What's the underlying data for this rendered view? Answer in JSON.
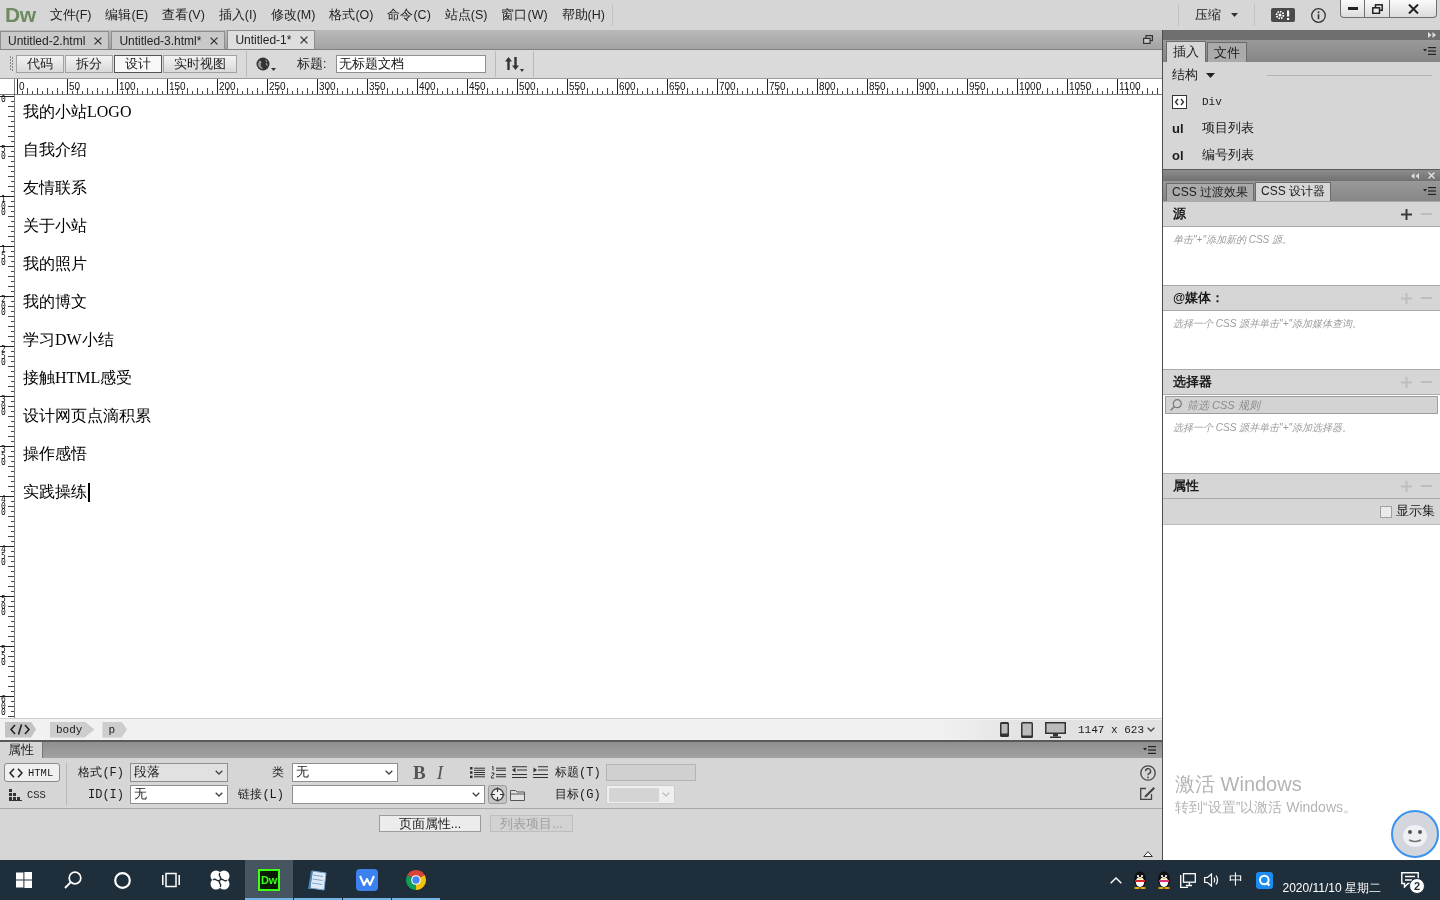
{
  "app": {
    "logo": "Dw",
    "menu": [
      "文件(F)",
      "编辑(E)",
      "查看(V)",
      "插入(I)",
      "修改(M)",
      "格式(O)",
      "命令(C)",
      "站点(S)",
      "窗口(W)",
      "帮助(H)"
    ],
    "workspace": "压缩"
  },
  "doc_tabs": [
    {
      "label": "Untitled-2.html",
      "selected": false
    },
    {
      "label": "Untitled-3.html*",
      "selected": false
    },
    {
      "label": "Untitled-1*",
      "selected": true
    }
  ],
  "toolbar": {
    "views": [
      {
        "label": "代码",
        "selected": false
      },
      {
        "label": "拆分",
        "selected": false
      },
      {
        "label": "设计",
        "selected": true
      },
      {
        "label": "实时视图",
        "selected": false
      }
    ],
    "title_label": "标题:",
    "title_value": "无标题文档"
  },
  "rulers": {
    "horizontal": [
      "0",
      "50",
      "100",
      "150",
      "200",
      "250",
      "300",
      "350",
      "400",
      "450",
      "500",
      "550",
      "600",
      "650",
      "700",
      "750",
      "800",
      "850",
      "900",
      "950",
      "1000",
      "1050",
      "1100"
    ],
    "vertical": [
      "0",
      "50",
      "100",
      "150",
      "200",
      "250",
      "300",
      "350",
      "400",
      "450",
      "500",
      "550",
      "600"
    ]
  },
  "document": {
    "paragraphs": [
      {
        "text": "我的小站LOGO",
        "caret": false
      },
      {
        "text": "自我介绍",
        "caret": false
      },
      {
        "text": "友情联系",
        "caret": false
      },
      {
        "text": "关于小站",
        "caret": false
      },
      {
        "text": "我的照片",
        "caret": false
      },
      {
        "text": "我的博文",
        "caret": false
      },
      {
        "text": "学习DW小结",
        "caret": false
      },
      {
        "text": "接触HTML感受",
        "caret": false
      },
      {
        "text": "设计网页点滴积累",
        "caret": false
      },
      {
        "text": "操作感悟",
        "caret": false
      },
      {
        "text": "实践操练",
        "caret": true
      }
    ]
  },
  "status_bar": {
    "tags": [
      "body",
      "p"
    ],
    "window_size": "1147 x 623"
  },
  "properties": {
    "title": "属性",
    "modes": [
      {
        "label": "HTML",
        "kind": "html",
        "selected": true
      },
      {
        "label": "CSS",
        "kind": "css",
        "selected": false
      }
    ],
    "format": {
      "label": "格式(F)",
      "value": "段落"
    },
    "id": {
      "label": "ID(I)",
      "value": "无"
    },
    "class": {
      "label": "类",
      "value": "无"
    },
    "link": {
      "label": "链接(L)"
    },
    "text_styles": [
      {
        "label": "B",
        "kind": "bold"
      },
      {
        "label": "I",
        "kind": "italic"
      }
    ],
    "heading": {
      "label": "标题(T)",
      "disabled": true
    },
    "target": {
      "label": "目标(G)",
      "disabled": true
    },
    "buttons": [
      {
        "label": "页面属性...",
        "disabled": false
      },
      {
        "label": "列表项目...",
        "disabled": true
      }
    ]
  },
  "insert_panel": {
    "tabs": [
      {
        "label": "插入",
        "selected": true
      },
      {
        "label": "文件",
        "selected": false
      }
    ],
    "category": "结构",
    "items": [
      {
        "kind": "icon",
        "label": "Div"
      },
      {
        "kind": "tag",
        "tag": "ul",
        "label": "项目列表"
      },
      {
        "kind": "tag",
        "tag": "ol",
        "label": "编号列表"
      }
    ]
  },
  "css_designer": {
    "tabs": [
      {
        "label": "CSS 过渡效果",
        "selected": false
      },
      {
        "label": "CSS 设计器",
        "selected": true
      }
    ],
    "sections": [
      {
        "title": "源",
        "add_enabled": true,
        "hint": "单击\"+\"添加新的 CSS 源。"
      },
      {
        "title": "@媒体：",
        "add_enabled": false,
        "hint": "选择一个 CSS 源并单击\"+\"添加媒体查询。"
      },
      {
        "title": "选择器",
        "add_enabled": false,
        "filter_placeholder": "筛选 CSS 规则",
        "hint": "选择一个 CSS 源并单击\"+\"添加选择器。"
      },
      {
        "title": "属性",
        "add_enabled": false,
        "show_set": {
          "label": "显示集",
          "checked": false
        }
      }
    ]
  },
  "activation": {
    "title": "激活 Windows",
    "subtitle": "转到“设置”以激活 Windows。"
  },
  "taskbar": {
    "apps": [
      {
        "kind": "pinwheel",
        "running": false,
        "selected": false
      },
      {
        "kind": "dw",
        "label": "Dw",
        "running": true,
        "selected": true
      },
      {
        "kind": "notepad",
        "running": true,
        "selected": false
      },
      {
        "kind": "wps",
        "running": true,
        "selected": false
      },
      {
        "kind": "chrome",
        "running": true,
        "selected": false
      }
    ],
    "tray": {
      "ime": "中",
      "date": "2020/11/10 星期二",
      "notifications": "2"
    }
  }
}
